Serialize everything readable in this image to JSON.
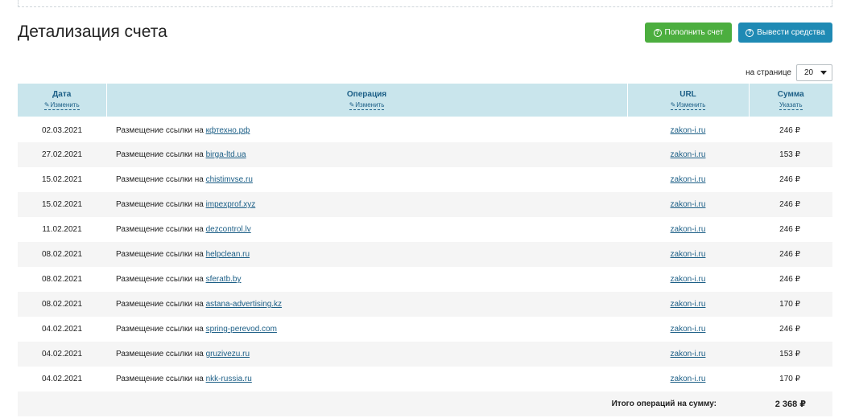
{
  "page": {
    "title": "Детализация счета",
    "buttons": {
      "topup": "Пополнить счет",
      "withdraw": "Вывести средства"
    },
    "per_page": {
      "label": "на странице",
      "value": "20"
    }
  },
  "table": {
    "columns": [
      {
        "title": "Дата",
        "action": "Изменить"
      },
      {
        "title": "Операция",
        "action": "Изменить"
      },
      {
        "title": "URL",
        "action": "Изменить"
      },
      {
        "title": "Сумма",
        "action": "Указать"
      }
    ],
    "op_prefix": "Размещение ссылки на",
    "rows": [
      {
        "date": "02.03.2021",
        "site": "кфтехно.рф",
        "url": "zakon-i.ru",
        "sum": "246 ₽"
      },
      {
        "date": "27.02.2021",
        "site": "birga-ltd.ua",
        "url": "zakon-i.ru",
        "sum": "153 ₽"
      },
      {
        "date": "15.02.2021",
        "site": "chistimvse.ru",
        "url": "zakon-i.ru",
        "sum": "246 ₽"
      },
      {
        "date": "15.02.2021",
        "site": "impexprof.xyz",
        "url": "zakon-i.ru",
        "sum": "246 ₽"
      },
      {
        "date": "11.02.2021",
        "site": "dezcontrol.lv",
        "url": "zakon-i.ru",
        "sum": "246 ₽"
      },
      {
        "date": "08.02.2021",
        "site": "helpclean.ru",
        "url": "zakon-i.ru",
        "sum": "246 ₽"
      },
      {
        "date": "08.02.2021",
        "site": "sferatb.by",
        "url": "zakon-i.ru",
        "sum": "246 ₽"
      },
      {
        "date": "08.02.2021",
        "site": "astana-advertising.kz",
        "url": "zakon-i.ru",
        "sum": "170 ₽"
      },
      {
        "date": "04.02.2021",
        "site": "spring-perevod.com",
        "url": "zakon-i.ru",
        "sum": "246 ₽"
      },
      {
        "date": "04.02.2021",
        "site": "gruzivezu.ru",
        "url": "zakon-i.ru",
        "sum": "153 ₽"
      },
      {
        "date": "04.02.2021",
        "site": "nkk-russia.ru",
        "url": "zakon-i.ru",
        "sum": "170 ₽"
      }
    ],
    "total_label": "Итого операций на сумму:",
    "total_value": "2 368 ₽"
  },
  "colors": {
    "accent_green": "#4cae3f",
    "accent_blue": "#1f8ab4",
    "header_bg": "#c9e5ec",
    "link": "#1b5e86"
  }
}
